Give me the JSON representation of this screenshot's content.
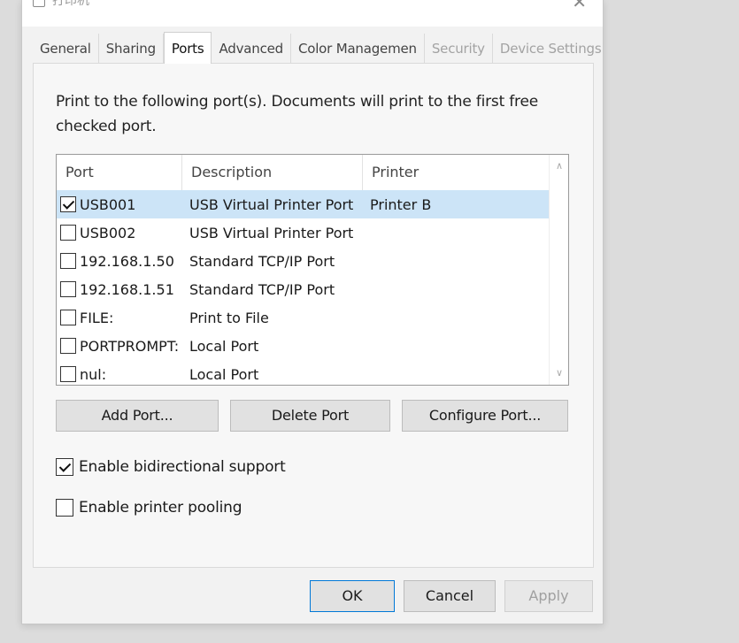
{
  "window": {
    "title": "打印机",
    "close_glyph": "✕"
  },
  "tabs": [
    {
      "label": "General",
      "state": "normal"
    },
    {
      "label": "Sharing",
      "state": "normal"
    },
    {
      "label": "Ports",
      "state": "active"
    },
    {
      "label": "Advanced",
      "state": "normal"
    },
    {
      "label": "Color Managemen",
      "state": "normal"
    },
    {
      "label": "Security",
      "state": "disabled"
    },
    {
      "label": "Device Settings",
      "state": "disabled"
    }
  ],
  "ports_panel": {
    "intro_text": "Print to the following port(s). Documents will print to the first free checked port.",
    "columns": {
      "port": "Port",
      "description": "Description",
      "printer": "Printer"
    },
    "rows": [
      {
        "port": "USB001",
        "description": "USB Virtual Printer Port",
        "printer": "Printer B",
        "checked": true,
        "selected": true
      },
      {
        "port": "USB002",
        "description": "USB Virtual Printer Port",
        "printer": "",
        "checked": false,
        "selected": false
      },
      {
        "port": "192.168.1.50",
        "description": "Standard TCP/IP Port",
        "printer": "",
        "checked": false,
        "selected": false
      },
      {
        "port": "192.168.1.51",
        "description": "Standard TCP/IP Port",
        "printer": "",
        "checked": false,
        "selected": false
      },
      {
        "port": "FILE:",
        "description": "Print to File",
        "printer": "",
        "checked": false,
        "selected": false
      },
      {
        "port": "PORTPROMPT:",
        "description": "Local Port",
        "printer": "",
        "checked": false,
        "selected": false
      },
      {
        "port": "nul:",
        "description": "Local Port",
        "printer": "",
        "checked": false,
        "selected": false
      }
    ],
    "scroll_up_glyph": "∧",
    "scroll_down_glyph": "∨",
    "buttons": {
      "add_port": "Add Port...",
      "delete_port": "Delete Port",
      "configure_port": "Configure Port..."
    },
    "options": {
      "bidirectional": {
        "label": "Enable bidirectional support",
        "checked": true
      },
      "pooling": {
        "label": "Enable printer pooling",
        "checked": false
      }
    }
  },
  "footer": {
    "ok": "OK",
    "cancel": "Cancel",
    "apply": "Apply"
  }
}
